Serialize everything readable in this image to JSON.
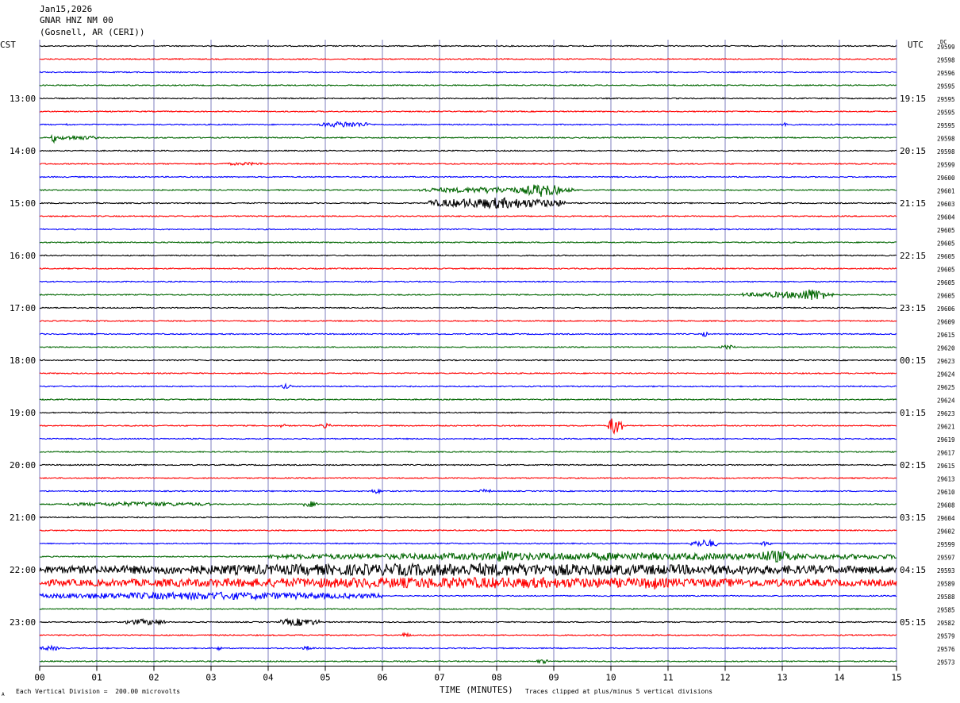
{
  "header": {
    "date": "Jan15,2026",
    "station": "GNAR HNZ NM 00",
    "location": "(Gosnell, AR (CERI))"
  },
  "left_tz": "CST",
  "right_tz": "UTC",
  "dc_label": "DC",
  "footer": {
    "scale": "Each Vertical Division =  200.00 microvolts",
    "clip": "Traces clipped at plus/minus 5 vertical divisions",
    "logo_mark": "A"
  },
  "colors": {
    "cycle": [
      "#000000",
      "#ff0000",
      "#0000ff",
      "#006600"
    ],
    "grid": "#7f7fbf"
  },
  "chart_data": {
    "type": "line",
    "xlabel": "TIME (MINUTES)",
    "ylabel": "",
    "x_ticks": [
      "00",
      "01",
      "02",
      "03",
      "04",
      "05",
      "06",
      "07",
      "08",
      "09",
      "10",
      "11",
      "12",
      "13",
      "14",
      "15"
    ],
    "xlim": [
      0,
      15
    ],
    "left_hour_labels": [
      "13:00",
      "14:00",
      "15:00",
      "16:00",
      "17:00",
      "18:00",
      "19:00",
      "20:00",
      "21:00",
      "22:00",
      "23:00"
    ],
    "right_hour_labels": [
      "19:15",
      "20:15",
      "21:15",
      "22:15",
      "23:15",
      "00:15",
      "01:15",
      "02:15",
      "03:15",
      "04:15",
      "05:15"
    ],
    "dc_values": [
      "29599",
      "29598",
      "29596",
      "29595",
      "29595",
      "29595",
      "29595",
      "29598",
      "29598",
      "29599",
      "29600",
      "29601",
      "29603",
      "29604",
      "29605",
      "29605",
      "29605",
      "29605",
      "29605",
      "29605",
      "29606",
      "29609",
      "29615",
      "29620",
      "29623",
      "29624",
      "29625",
      "29624",
      "29623",
      "29621",
      "29619",
      "29617",
      "29615",
      "29613",
      "29610",
      "29608",
      "29604",
      "29602",
      "29599",
      "29597",
      "29593",
      "29589",
      "29588",
      "29585",
      "29582",
      "29579",
      "29576",
      "29573"
    ],
    "rows": 48,
    "events": [
      {
        "row": 6,
        "start": 0.4,
        "end": 0.5,
        "amp": 2
      },
      {
        "row": 6,
        "start": 4.9,
        "end": 5.8,
        "amp": 4
      },
      {
        "row": 6,
        "start": 13.0,
        "end": 13.1,
        "amp": 5
      },
      {
        "row": 7,
        "start": 0.2,
        "end": 1.0,
        "amp": 3
      },
      {
        "row": 7,
        "start": 0.2,
        "end": 0.3,
        "amp": 6
      },
      {
        "row": 9,
        "start": 3.2,
        "end": 4.0,
        "amp": 2
      },
      {
        "row": 11,
        "start": 6.6,
        "end": 9.4,
        "amp": 4
      },
      {
        "row": 11,
        "start": 8.5,
        "end": 9.1,
        "amp": 9
      },
      {
        "row": 12,
        "start": 6.8,
        "end": 9.2,
        "amp": 7
      },
      {
        "row": 19,
        "start": 12.3,
        "end": 13.9,
        "amp": 4
      },
      {
        "row": 19,
        "start": 13.2,
        "end": 13.8,
        "amp": 8
      },
      {
        "row": 22,
        "start": 11.6,
        "end": 11.7,
        "amp": 4
      },
      {
        "row": 23,
        "start": 11.9,
        "end": 12.2,
        "amp": 3
      },
      {
        "row": 26,
        "start": 4.2,
        "end": 4.4,
        "amp": 3
      },
      {
        "row": 29,
        "start": 4.2,
        "end": 4.3,
        "amp": 3
      },
      {
        "row": 29,
        "start": 4.9,
        "end": 5.1,
        "amp": 3
      },
      {
        "row": 29,
        "start": 9.95,
        "end": 10.2,
        "amp": 12
      },
      {
        "row": 34,
        "start": 5.8,
        "end": 6.0,
        "amp": 3
      },
      {
        "row": 34,
        "start": 7.7,
        "end": 7.9,
        "amp": 3
      },
      {
        "row": 35,
        "start": 0.5,
        "end": 3.0,
        "amp": 3
      },
      {
        "row": 35,
        "start": 4.6,
        "end": 4.9,
        "amp": 4
      },
      {
        "row": 38,
        "start": 11.4,
        "end": 11.9,
        "amp": 5
      },
      {
        "row": 38,
        "start": 12.6,
        "end": 12.8,
        "amp": 3
      },
      {
        "row": 39,
        "start": 4.0,
        "end": 15.0,
        "amp": 5
      },
      {
        "row": 39,
        "start": 7.9,
        "end": 8.4,
        "amp": 8
      },
      {
        "row": 39,
        "start": 12.4,
        "end": 13.3,
        "amp": 8
      },
      {
        "row": 40,
        "start": 0.0,
        "end": 15.0,
        "amp": 8
      },
      {
        "row": 41,
        "start": 0.0,
        "end": 15.0,
        "amp": 7
      },
      {
        "row": 41,
        "start": 10.6,
        "end": 10.8,
        "amp": 12
      },
      {
        "row": 42,
        "start": 0.0,
        "end": 6.0,
        "amp": 5
      },
      {
        "row": 44,
        "start": 1.5,
        "end": 2.2,
        "amp": 4
      },
      {
        "row": 44,
        "start": 4.2,
        "end": 4.9,
        "amp": 5
      },
      {
        "row": 45,
        "start": 6.3,
        "end": 6.5,
        "amp": 3
      },
      {
        "row": 46,
        "start": 0.0,
        "end": 0.4,
        "amp": 3
      },
      {
        "row": 46,
        "start": 3.1,
        "end": 3.2,
        "amp": 3
      },
      {
        "row": 46,
        "start": 4.6,
        "end": 4.8,
        "amp": 3
      },
      {
        "row": 47,
        "start": 8.7,
        "end": 8.9,
        "amp": 3
      }
    ]
  }
}
